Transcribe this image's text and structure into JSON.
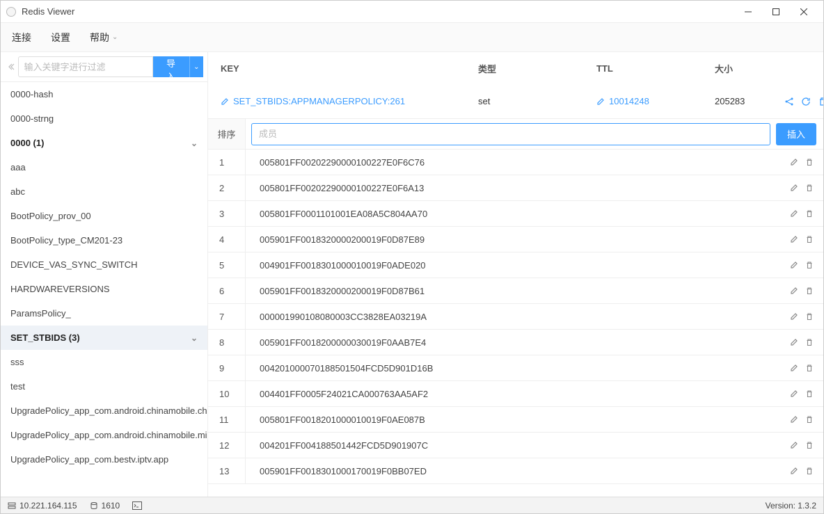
{
  "window": {
    "title": "Redis Viewer"
  },
  "menubar": {
    "items": [
      "连接",
      "设置",
      "帮助"
    ]
  },
  "sidebar": {
    "search_placeholder": "输入关键字进行过滤",
    "import_label": "导入",
    "items": [
      {
        "label": "0000-hash"
      },
      {
        "label": "0000-strng"
      },
      {
        "label": "0000 (1)",
        "bold": true,
        "chevron": true
      },
      {
        "label": "aaa"
      },
      {
        "label": "abc"
      },
      {
        "label": "BootPolicy_prov_00"
      },
      {
        "label": "BootPolicy_type_CM201-23"
      },
      {
        "label": "DEVICE_VAS_SYNC_SWITCH"
      },
      {
        "label": "HARDWAREVERSIONS"
      },
      {
        "label": "ParamsPolicy_"
      },
      {
        "label": "SET_STBIDS (3)",
        "bold": true,
        "chevron": true,
        "selected": true
      },
      {
        "label": "sss"
      },
      {
        "label": "test"
      },
      {
        "label": "UpgradePolicy_app_com.android.chinamobile.ch..."
      },
      {
        "label": "UpgradePolicy_app_com.android.chinamobile.mi..."
      },
      {
        "label": "UpgradePolicy_app_com.bestv.iptv.app"
      }
    ]
  },
  "columns": {
    "key": "KEY",
    "type": "类型",
    "ttl": "TTL",
    "size": "大小"
  },
  "key_detail": {
    "name": "SET_STBIDS:APPMANAGERPOLICY:261",
    "type": "set",
    "ttl": "10014248",
    "size": "205283"
  },
  "member_bar": {
    "sort": "排序",
    "placeholder": "成员",
    "insert": "插入"
  },
  "rows": [
    {
      "idx": "1",
      "val": "005801FF00202290000100227E0F6C76"
    },
    {
      "idx": "2",
      "val": "005801FF00202290000100227E0F6A13"
    },
    {
      "idx": "3",
      "val": "005801FF0001101001EA08A5C804AA70"
    },
    {
      "idx": "4",
      "val": "005901FF0018320000200019F0D87E89"
    },
    {
      "idx": "5",
      "val": "004901FF0018301000010019F0ADE020"
    },
    {
      "idx": "6",
      "val": "005901FF0018320000200019F0D87B61"
    },
    {
      "idx": "7",
      "val": "000001990108080003CC3828EA03219A"
    },
    {
      "idx": "8",
      "val": "005901FF0018200000030019F0AAB7E4"
    },
    {
      "idx": "9",
      "val": "004201000070188501504FCD5D901D16B"
    },
    {
      "idx": "10",
      "val": "004401FF0005F24021CA000763AA5AF2"
    },
    {
      "idx": "11",
      "val": "005801FF0018201000010019F0AE087B"
    },
    {
      "idx": "12",
      "val": "004201FF004188501442FCD5D901907C"
    },
    {
      "idx": "13",
      "val": "005901FF0018301000170019F0BB07ED"
    }
  ],
  "statusbar": {
    "host": "10.221.164.115",
    "count": "1610",
    "version": "Version: 1.3.2"
  }
}
